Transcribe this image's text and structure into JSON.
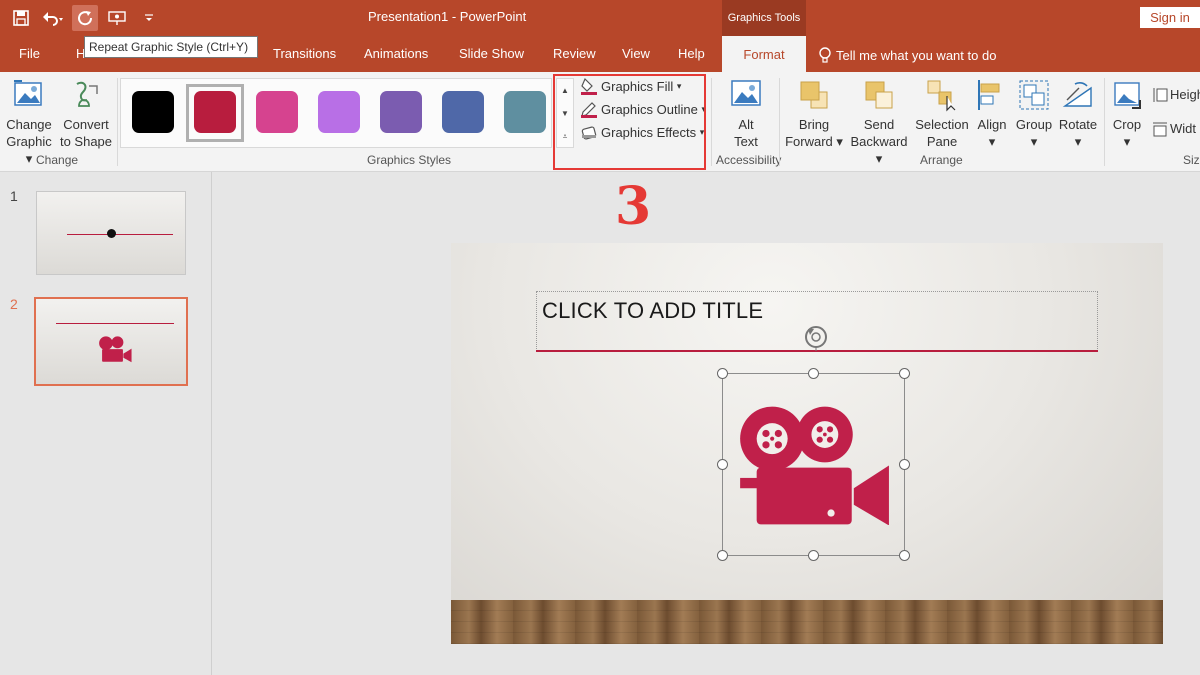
{
  "app": {
    "title": "Presentation1  -  PowerPoint",
    "tools_tab": "Graphics Tools",
    "signin": "Sign in",
    "tooltip": "Repeat Graphic Style (Ctrl+Y)"
  },
  "tabs": [
    "File",
    "H",
    "Transitions",
    "Animations",
    "Slide Show",
    "Review",
    "View",
    "Help",
    "Format"
  ],
  "tellme": "Tell me what you want to do",
  "ribbon": {
    "change_graphic": [
      "Change",
      "Graphic"
    ],
    "convert_shape": [
      "Convert",
      "to Shape"
    ],
    "change_group": "Change",
    "styles_group": "Graphics Styles",
    "swatch_colors": [
      "#000000",
      "#b81d3e",
      "#d6438f",
      "#b86fe6",
      "#7b5cb0",
      "#4f68a8",
      "#5f8fa0"
    ],
    "graphics_fill": "Graphics Fill",
    "graphics_outline": "Graphics Outline",
    "graphics_effects": "Graphics Effects",
    "alt_text": [
      "Alt",
      "Text"
    ],
    "accessibility_group": "Accessibility",
    "bring_forward": [
      "Bring",
      "Forward"
    ],
    "send_backward": [
      "Send",
      "Backward"
    ],
    "selection_pane": [
      "Selection",
      "Pane"
    ],
    "align": "Align",
    "group": "Group",
    "rotate": "Rotate",
    "arrange_group": "Arrange",
    "crop": "Crop",
    "height": "Heigh",
    "width": "Widt",
    "size_group": "Siz"
  },
  "annotation": "3",
  "slides": [
    "1",
    "2"
  ],
  "slide": {
    "title_placeholder": "CLICK TO ADD TITLE"
  },
  "colors": {
    "accent": "#b7472a",
    "icon_red": "#c0204a",
    "highlight_box": "#e53935"
  }
}
